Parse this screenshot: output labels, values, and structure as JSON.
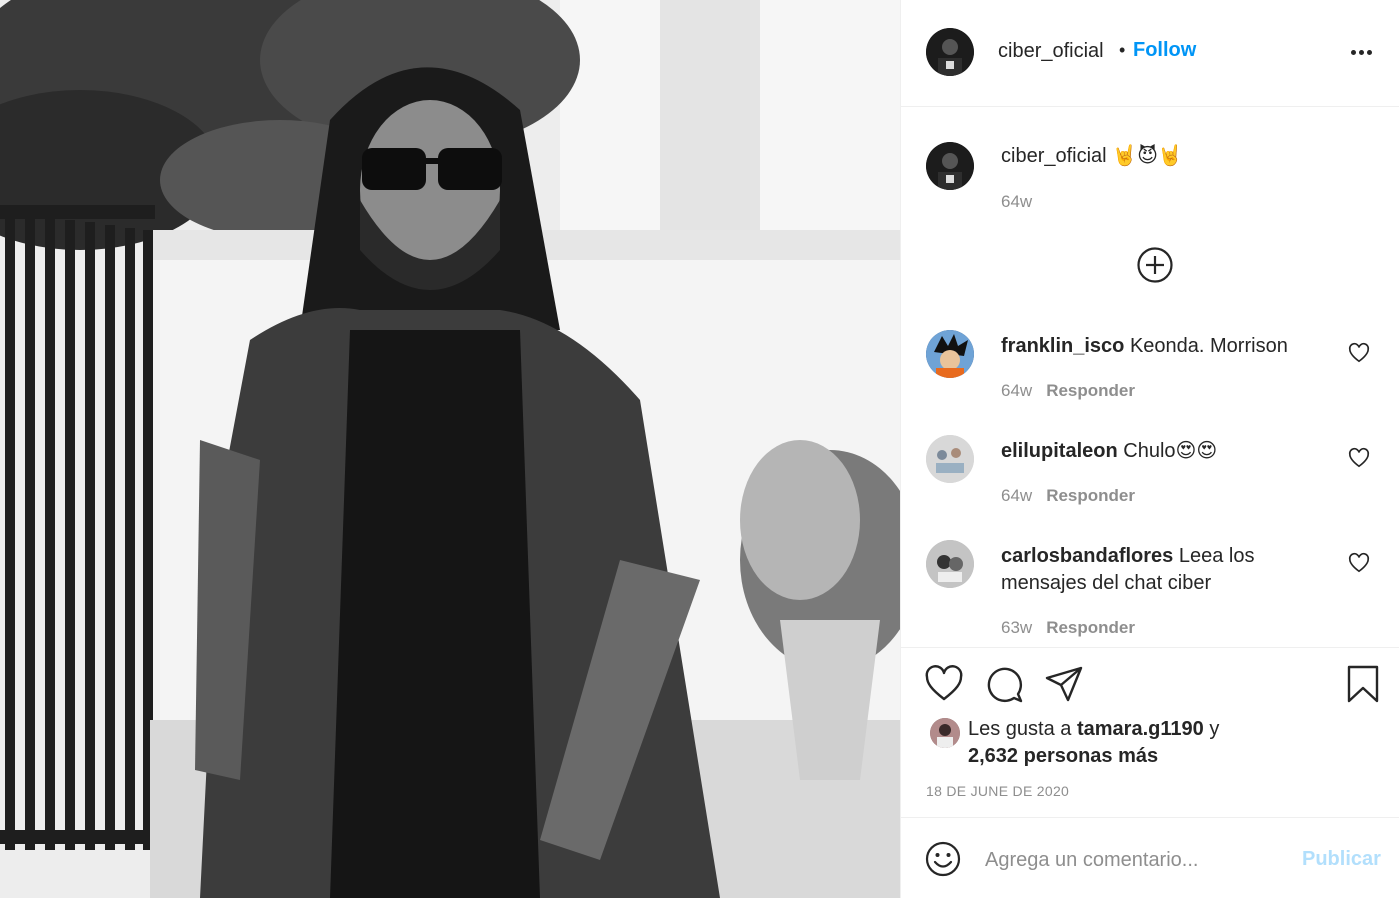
{
  "post": {
    "author": "ciber_oficial",
    "separator": "•",
    "follow_label": "Follow",
    "more_icon": "more-options-icon"
  },
  "caption": {
    "user": "ciber_oficial",
    "text": "🤘😈🤘",
    "time": "64w"
  },
  "load_more_icon": "plus-circle-icon",
  "comments": [
    {
      "user": "franklin_isco",
      "text": "Keonda. Morrison",
      "time": "64w",
      "reply": "Responder"
    },
    {
      "user": "elilupitaleon",
      "text": "Chulo😍😍",
      "time": "64w",
      "reply": "Responder"
    },
    {
      "user": "carlosbandaflores",
      "text": "Leea los mensajes del chat ciber",
      "time": "63w",
      "reply": "Responder"
    }
  ],
  "actions": {
    "like_icon": "heart-icon",
    "comment_icon": "comment-icon",
    "share_icon": "send-icon",
    "save_icon": "bookmark-icon"
  },
  "likes": {
    "prefix": "Les gusta a",
    "user": "tamara.g1190",
    "conj": "y",
    "others": "2,632 personas más"
  },
  "date": "18 DE JUNE DE 2020",
  "add_comment": {
    "placeholder": "Agrega un comentario...",
    "publish_label": "Publicar",
    "emoji_icon": "smiley-icon"
  },
  "colors": {
    "accent": "#0095f6",
    "publish_disabled": "#b2dffc",
    "text": "#262626",
    "muted": "#8e8e8e",
    "border": "#efefef"
  }
}
